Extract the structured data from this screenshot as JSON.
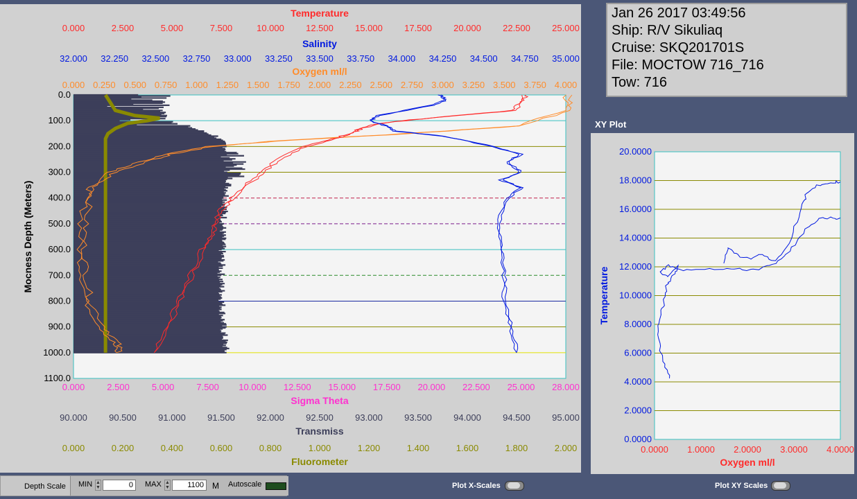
{
  "info": {
    "datetime": "Jan 26 2017 03:49:56",
    "ship": "Ship: R/V Sikuliaq",
    "cruise": "Cruise: SKQ201701S",
    "file": "File: MOCTOW 716_716",
    "tow": "Tow: 716"
  },
  "xy_plot_title": "XY Plot",
  "controls": {
    "depth_scale_label": "Depth Scale",
    "min_label": "MIN",
    "min_value": "0",
    "max_label": "MAX",
    "max_value": "1100",
    "unit": "M",
    "autoscale_label": "Autoscale",
    "plot_x_scales": "Plot X-Scales",
    "plot_xy_scales": "Plot XY Scales"
  },
  "colors": {
    "temperature": "#ff2a2a",
    "salinity": "#0018e0",
    "oxygen": "#ff8c2a",
    "sigma_theta": "#ff30d0",
    "transmiss": "#3d3f5a",
    "fluorometer": "#8a8a00"
  },
  "chart_data": [
    {
      "type": "line",
      "ylabel": "Mocness Depth (Meters)",
      "ylim": [
        1100,
        0
      ],
      "y_ticks": [
        "0.0",
        "100.0",
        "200.0",
        "300.0",
        "400.0",
        "500.0",
        "600.0",
        "700.0",
        "800.0",
        "900.0",
        "1000.0",
        "1100.0"
      ],
      "top_axes": [
        {
          "name": "Temperature",
          "range": [
            0,
            25
          ],
          "ticks": [
            "0.000",
            "2.500",
            "5.000",
            "7.500",
            "10.000",
            "12.500",
            "15.000",
            "17.500",
            "20.000",
            "22.500",
            "25.000"
          ]
        },
        {
          "name": "Salinity",
          "range": [
            32,
            35
          ],
          "ticks": [
            "32.000",
            "32.250",
            "32.500",
            "32.750",
            "33.000",
            "33.250",
            "33.500",
            "33.750",
            "34.000",
            "34.250",
            "34.500",
            "34.750",
            "35.000"
          ]
        },
        {
          "name": "Oxygen ml/l",
          "range": [
            0,
            4
          ],
          "ticks": [
            "0.000",
            "0.250",
            "0.500",
            "0.750",
            "1.000",
            "1.250",
            "1.500",
            "1.750",
            "2.000",
            "2.250",
            "2.500",
            "2.750",
            "3.000",
            "3.250",
            "3.500",
            "3.750",
            "4.000"
          ]
        }
      ],
      "bottom_axes": [
        {
          "name": "Sigma Theta",
          "range": [
            0,
            28
          ],
          "ticks": [
            "0.000",
            "2.500",
            "5.000",
            "7.500",
            "10.000",
            "12.500",
            "15.000",
            "17.500",
            "20.000",
            "22.500",
            "25.000",
            "28.000"
          ]
        },
        {
          "name": "Transmiss",
          "range": [
            90,
            95
          ],
          "ticks": [
            "90.000",
            "90.500",
            "91.000",
            "91.500",
            "92.000",
            "92.500",
            "93.000",
            "93.500",
            "94.000",
            "94.500",
            "95.000"
          ]
        },
        {
          "name": "Fluorometer",
          "range": [
            0,
            2
          ],
          "ticks": [
            "0.000",
            "0.200",
            "0.400",
            "0.600",
            "0.800",
            "1.000",
            "1.200",
            "1.400",
            "1.600",
            "1.800",
            "2.000"
          ]
        }
      ],
      "series": [
        {
          "name": "Temperature",
          "axis": 0,
          "depth": [
            0,
            20,
            60,
            90,
            110,
            130,
            150,
            170,
            200,
            250,
            300,
            350,
            400,
            450,
            500,
            550,
            600,
            700,
            800,
            900,
            1000
          ],
          "values": [
            22.9,
            22.7,
            22.3,
            18.0,
            15.5,
            14.5,
            14.0,
            13.2,
            11.7,
            10.3,
            9.6,
            8.7,
            8.0,
            7.4,
            7.1,
            6.9,
            6.5,
            5.9,
            5.3,
            4.7,
            4.1
          ]
        },
        {
          "name": "Salinity",
          "axis": 1,
          "depth": [
            0,
            20,
            40,
            80,
            100,
            120,
            140,
            160,
            200,
            230,
            260,
            300,
            330,
            360,
            400,
            500,
            600,
            700,
            800,
            900,
            1000
          ],
          "values": [
            34.23,
            34.26,
            34.18,
            33.85,
            33.8,
            33.9,
            33.95,
            34.25,
            34.55,
            34.72,
            34.64,
            34.72,
            34.6,
            34.72,
            34.64,
            34.58,
            34.6,
            34.62,
            34.62,
            34.66,
            34.7
          ]
        },
        {
          "name": "Oxygen ml/l",
          "axis": 2,
          "depth": [
            0,
            60,
            120,
            150,
            180,
            200,
            230,
            260,
            300,
            350,
            400,
            500,
            600,
            700,
            800,
            900,
            960,
            1000
          ],
          "values": [
            4.0,
            4.0,
            3.6,
            2.7,
            1.6,
            1.1,
            0.75,
            0.55,
            0.3,
            0.15,
            0.1,
            0.06,
            0.05,
            0.07,
            0.1,
            0.22,
            0.32,
            0.35
          ]
        },
        {
          "name": "Fluorometer",
          "axis": 5,
          "depth": [
            0,
            30,
            60,
            80,
            90,
            100,
            110,
            130,
            150,
            170,
            200,
            400,
            1000
          ],
          "values": [
            0.13,
            0.15,
            0.17,
            0.25,
            0.35,
            0.3,
            0.22,
            0.17,
            0.14,
            0.13,
            0.13,
            0.13,
            0.13
          ]
        },
        {
          "name": "Transmiss",
          "axis": 4,
          "depth": [
            0,
            100,
            140,
            160,
            180,
            200,
            300,
            400,
            500,
            700,
            900,
            1000
          ],
          "values": [
            91.0,
            91.0,
            91.3,
            91.45,
            91.5,
            91.55,
            91.6,
            91.55,
            91.52,
            91.5,
            91.52,
            91.55
          ]
        }
      ]
    },
    {
      "type": "line",
      "title": "XY Plot",
      "xlabel": "Oxygen ml/l",
      "ylabel": "Temperature",
      "xlim": [
        0,
        4
      ],
      "ylim": [
        0,
        20
      ],
      "x_ticks": [
        "0.0000",
        "1.0000",
        "2.0000",
        "3.0000",
        "4.0000"
      ],
      "y_ticks": [
        "0.0000",
        "2.0000",
        "4.0000",
        "6.0000",
        "8.0000",
        "10.0000",
        "12.0000",
        "14.0000",
        "16.0000",
        "18.0000",
        "20.0000"
      ],
      "series": [
        {
          "x": [
            0.33,
            0.2,
            0.12,
            0.08,
            0.12,
            0.2,
            0.25,
            0.4,
            0.5,
            0.3,
            0.1,
            0.3,
            0.5,
            1.0,
            1.5,
            1.9,
            2.3,
            2.6,
            2.9,
            3.2,
            3.5,
            3.8,
            4.0
          ],
          "y": [
            4.3,
            5.2,
            6.2,
            7.5,
            8.6,
            9.4,
            10.6,
            11.4,
            12.0,
            11.4,
            11.6,
            12.1,
            11.8,
            11.9,
            11.9,
            11.8,
            11.9,
            12.2,
            13.0,
            14.4,
            15.3,
            15.4,
            15.4
          ]
        },
        {
          "x": [
            1.5,
            1.6,
            1.8,
            2.1,
            2.3,
            2.6,
            2.9,
            3.1,
            3.2,
            3.3,
            3.5,
            3.8,
            4.0
          ],
          "y": [
            12.3,
            13.4,
            12.8,
            12.5,
            12.9,
            12.4,
            13.7,
            15.5,
            16.5,
            17.2,
            17.6,
            17.9,
            17.9
          ]
        }
      ]
    }
  ]
}
